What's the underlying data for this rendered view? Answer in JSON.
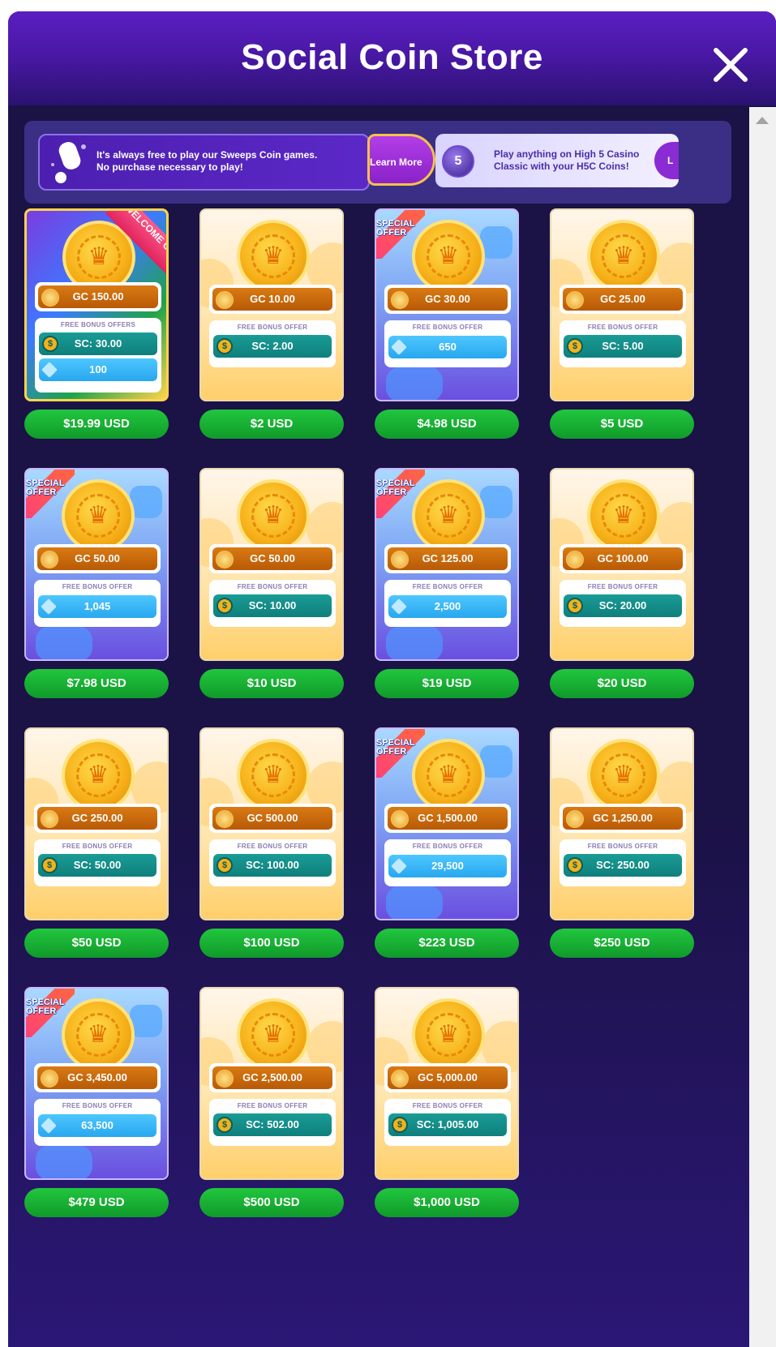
{
  "header": {
    "title": "Social Coin Store"
  },
  "banners": {
    "sweeps": {
      "line1": "It's always free to play our Sweeps Coin games.",
      "line2": "No purchase necessary to play!"
    },
    "learn_more_label": "Learn More",
    "h5c": {
      "badge": "5",
      "line1": "Play anything on High 5 Casino",
      "line2": "Classic with your H5C Coins!",
      "button_label": "L"
    }
  },
  "packs": [
    {
      "gc": "GC 150.00",
      "bonus_label": "FREE BONUS OFFERS",
      "sc": "SC: 30.00",
      "gems": "100",
      "price": "$19.99 USD",
      "style": "welcome",
      "tag": "WELCOME OFFER"
    },
    {
      "gc": "GC 10.00",
      "bonus_label": "FREE BONUS OFFER",
      "sc": "SC: 2.00",
      "price": "$2 USD",
      "style": "gold"
    },
    {
      "gc": "GC 30.00",
      "bonus_label": "FREE BONUS OFFER",
      "gems": "650",
      "price": "$4.98 USD",
      "style": "blue",
      "tag": "SPECIAL OFFER"
    },
    {
      "gc": "GC 25.00",
      "bonus_label": "FREE BONUS OFFER",
      "sc": "SC: 5.00",
      "price": "$5 USD",
      "style": "gold"
    },
    {
      "gc": "GC 50.00",
      "bonus_label": "FREE BONUS OFFER",
      "gems": "1,045",
      "price": "$7.98 USD",
      "style": "blue",
      "tag": "SPECIAL OFFER"
    },
    {
      "gc": "GC 50.00",
      "bonus_label": "FREE BONUS OFFER",
      "sc": "SC: 10.00",
      "price": "$10 USD",
      "style": "gold"
    },
    {
      "gc": "GC 125.00",
      "bonus_label": "FREE BONUS OFFER",
      "gems": "2,500",
      "price": "$19 USD",
      "style": "blue",
      "tag": "SPECIAL OFFER"
    },
    {
      "gc": "GC 100.00",
      "bonus_label": "FREE BONUS OFFER",
      "sc": "SC: 20.00",
      "price": "$20 USD",
      "style": "gold"
    },
    {
      "gc": "GC 250.00",
      "bonus_label": "FREE BONUS OFFER",
      "sc": "SC: 50.00",
      "price": "$50 USD",
      "style": "gold"
    },
    {
      "gc": "GC 500.00",
      "bonus_label": "FREE BONUS OFFER",
      "sc": "SC: 100.00",
      "price": "$100 USD",
      "style": "gold"
    },
    {
      "gc": "GC 1,500.00",
      "bonus_label": "FREE BONUS OFFER",
      "gems": "29,500",
      "price": "$223 USD",
      "style": "blue",
      "tag": "SPECIAL OFFER"
    },
    {
      "gc": "GC 1,250.00",
      "bonus_label": "FREE BONUS OFFER",
      "sc": "SC: 250.00",
      "price": "$250 USD",
      "style": "gold"
    },
    {
      "gc": "GC 3,450.00",
      "bonus_label": "FREE BONUS OFFER",
      "gems": "63,500",
      "price": "$479 USD",
      "style": "blue",
      "tag": "SPECIAL OFFER"
    },
    {
      "gc": "GC 2,500.00",
      "bonus_label": "FREE BONUS OFFER",
      "sc": "SC: 502.00",
      "price": "$500 USD",
      "style": "gold"
    },
    {
      "gc": "GC 5,000.00",
      "bonus_label": "FREE BONUS OFFER",
      "sc": "SC: 1,005.00",
      "price": "$1,000 USD",
      "style": "gold"
    }
  ],
  "colors": {
    "header": "#4a18a6",
    "background": "#1b1246",
    "price_button": "#17b035",
    "gc_bar": "#c8680c",
    "sc_bar": "#13908b",
    "gem_bar": "#35b5f5"
  },
  "icons": {
    "close": "close-icon",
    "gold_coin": "gold-coin-icon",
    "sweeps_coin": "sweeps-coin-icon",
    "gem": "diamond-icon"
  }
}
